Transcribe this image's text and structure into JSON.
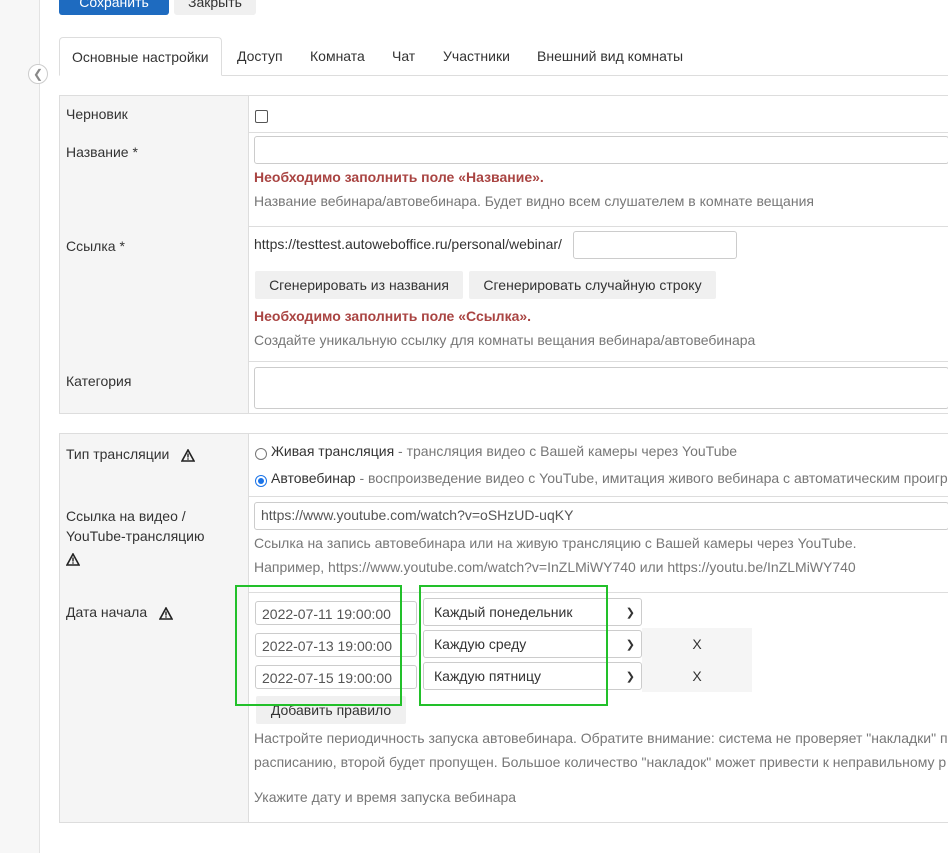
{
  "toolbar": {
    "save_label": "Сохранить",
    "close_label": "Закрыть"
  },
  "tabs": [
    "Основные настройки",
    "Доступ",
    "Комната",
    "Чат",
    "Участники",
    "Внешний вид комнаты"
  ],
  "draft": {
    "label": "Черновик",
    "checked": false
  },
  "name_field": {
    "label": "Название *",
    "value": "",
    "error": "Необходимо заполнить поле «Название».",
    "hint": "Название вебинара/автовебинара. Будет видно всем слушателем в комнате вещания"
  },
  "link_field": {
    "label": "Ссылка *",
    "prefix": "https://testtest.autoweboffice.ru/personal/webinar/",
    "value": "",
    "gen_from_name": "Сгенерировать из названия",
    "gen_random": "Сгенерировать случайную строку",
    "error": "Необходимо заполнить поле «Ссылка».",
    "hint": "Создайте уникальную ссылку для комнаты вещания вебинара/автовебинара"
  },
  "category_field": {
    "label": "Категория",
    "value": ""
  },
  "broadcast_type": {
    "label": "Тип трансляции",
    "options": [
      {
        "title": "Живая трансляция",
        "desc": " - трансляция видео с Вашей камеры через YouTube",
        "selected": false
      },
      {
        "title": "Автовебинар",
        "desc": " - воспроизведение видео с YouTube, имитация живого вебинара с автоматическим проигр",
        "selected": true
      }
    ]
  },
  "video_link": {
    "label": "Ссылка на видео / YouTube-трансляцию",
    "value": "https://www.youtube.com/watch?v=oSHzUD-uqKY",
    "hint1": "Ссылка на запись автовебинара или на живую трансляцию с Вашей камеры через YouTube.",
    "hint2": "Например, https://www.youtube.com/watch?v=InZLMiWY740 или https://youtu.be/InZLMiWY740"
  },
  "start_date": {
    "label": "Дата начала",
    "rules": [
      {
        "date": "2022-07-11 19:00:00",
        "repeat": "Каждый понедельник",
        "remove": ""
      },
      {
        "date": "2022-07-13 19:00:00",
        "repeat": "Каждую среду",
        "remove": "X"
      },
      {
        "date": "2022-07-15 19:00:00",
        "repeat": "Каждую пятницу",
        "remove": "X"
      }
    ],
    "add_rule": "Добавить правило",
    "hint1": "Настройте периодичность запуска автовебинара. Обратите внимание: система не проверяет \"накладки\" по",
    "hint2": "расписанию, второй будет пропущен. Большое количество \"накладок\" может привести к неправильному р",
    "hint3": "Укажите дату и время запуска вебинара"
  },
  "colors": {
    "primary": "#1e6bc0",
    "error": "#a94442",
    "highlight": "#22c02a",
    "radio": "#1a73e8"
  }
}
